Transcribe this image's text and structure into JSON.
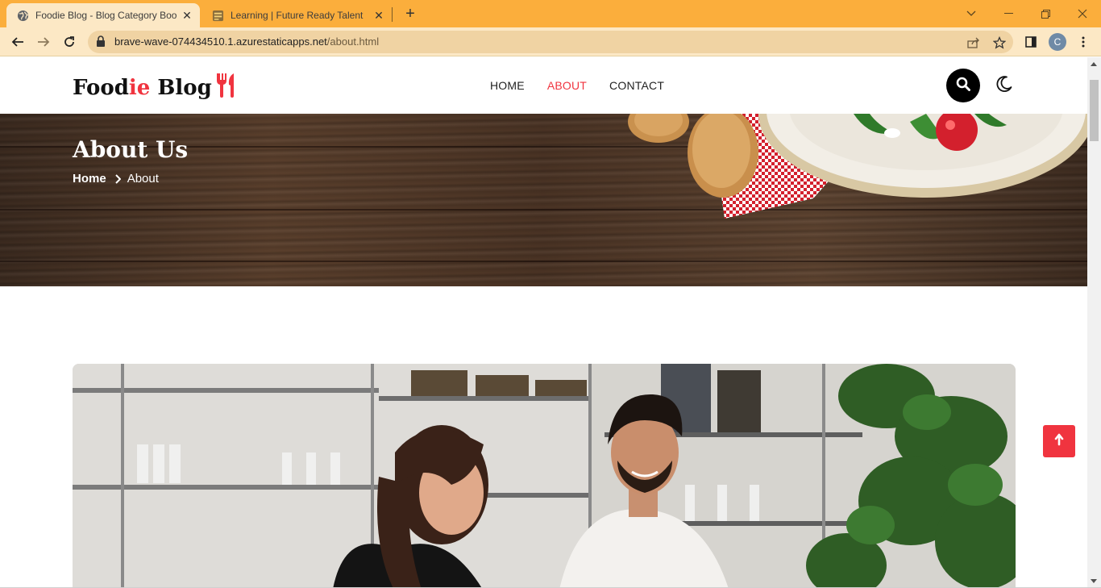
{
  "browser": {
    "tabs": [
      {
        "title": "Foodie Blog - Blog Category Boo",
        "active": true
      },
      {
        "title": "Learning | Future Ready Talent",
        "active": false
      }
    ],
    "url_host": "brave-wave-074434510.1.azurestaticapps.net",
    "url_path": "/about.html",
    "profile_initial": "C",
    "theme_color": "#fbae3c"
  },
  "site": {
    "logo": {
      "part1": "Food",
      "accent": "ie",
      "part2": " Blog"
    },
    "nav": [
      {
        "label": "HOME",
        "active": false
      },
      {
        "label": "ABOUT",
        "active": true
      },
      {
        "label": "CONTACT",
        "active": false
      }
    ],
    "accent_color": "#f0343f"
  },
  "hero": {
    "title": "About Us",
    "breadcrumb": {
      "home": "Home",
      "current": "About"
    }
  }
}
